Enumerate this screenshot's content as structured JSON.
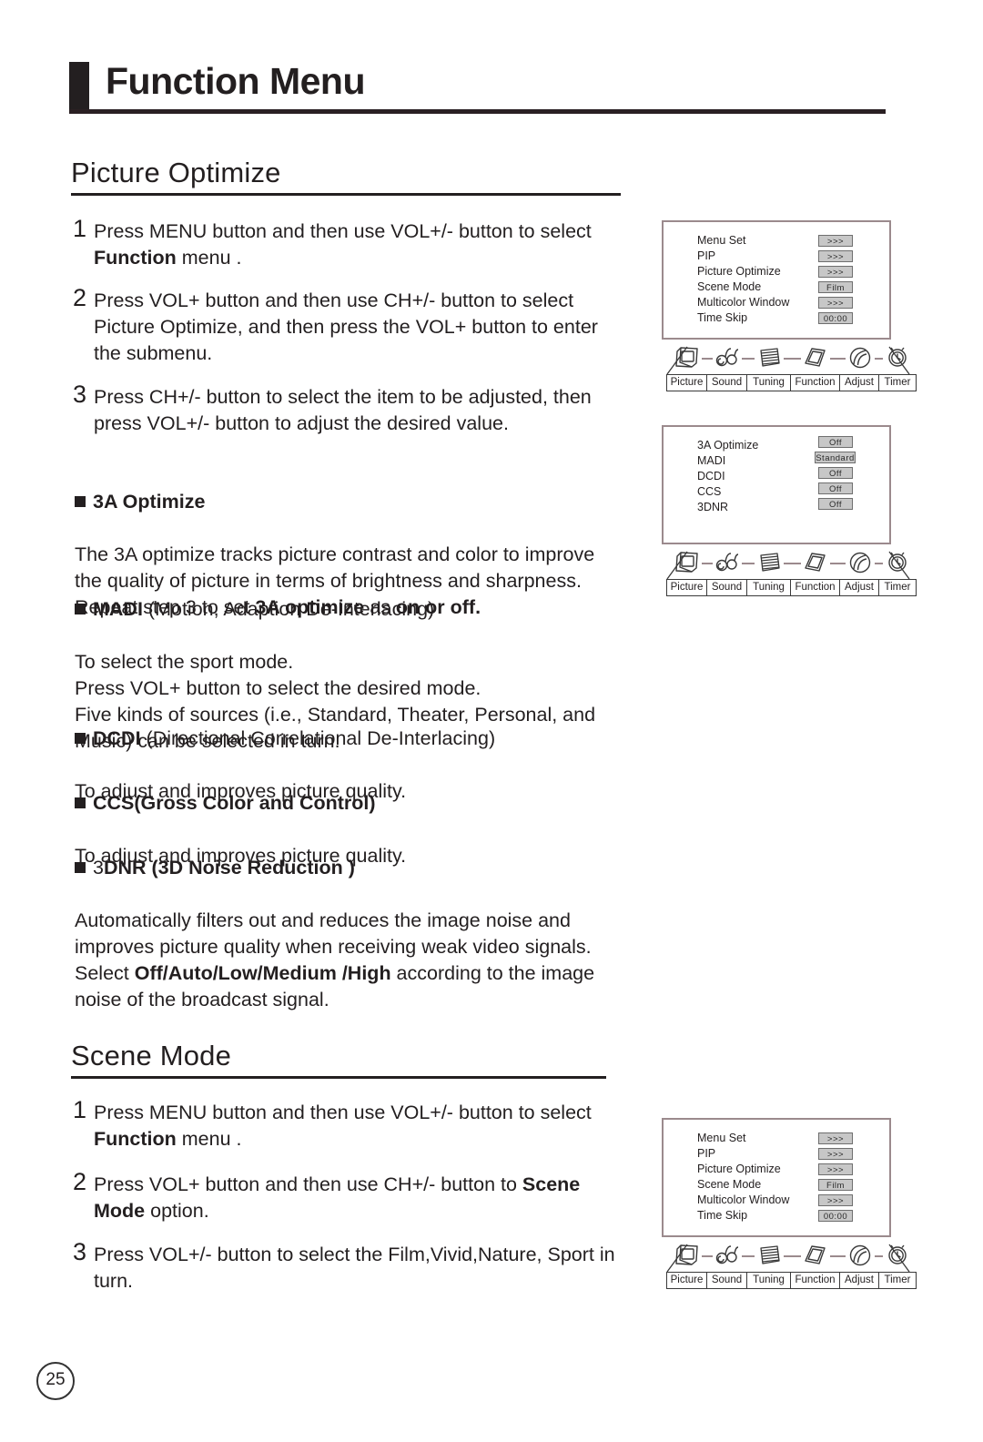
{
  "document": {
    "title": "Function Menu",
    "page_number": "25"
  },
  "sections": [
    {
      "heading": "Picture Optimize",
      "steps": [
        {
          "num": "1",
          "html": "Press MENU button and then use VOL+/- button to select <b>Function</b> menu ."
        },
        {
          "num": "2",
          "html": "Press VOL+ button and then use CH+/- button to select Picture Optimize, and then press the VOL+ button to enter the submenu."
        },
        {
          "num": "3",
          "html": "Press CH+/- button to select the item to be adjusted, then press VOL+/- button to adjust the desired value."
        }
      ],
      "topics": [
        {
          "title": "3A Optimize",
          "title_html": "<span class=\"bhead\">3A Optimize</span>",
          "body_html": "The 3A optimize tracks picture contrast and color to improve<br>the quality of picture in terms of brightness and sharpness.<br>Repeat step 3 to set <b>3A optimize</b> as <b>on or off.</b>"
        },
        {
          "title": "MADI (Motion, Adaption De-Interlacing)",
          "title_html": "<span class=\"bhead\">MADI</span> (Motion, Adaption De-Interlacing)",
          "body_html": "To select the sport mode.<br>Press VOL+ button to select the desired mode.<br>Five kinds of sources (i.e., Standard, Theater, Personal, and<br>Music) can be selected in turn."
        },
        {
          "title": "DCDI (Directional Correlational De-Interlacing)",
          "title_html": "<span class=\"bhead\">DCDI</span> (Directional Correlational De-Interlacing)",
          "body_html": "To adjust and improves picture quality."
        },
        {
          "title": "CCS(Gross Color and Control)",
          "title_html": "<span class=\"bhead\">CCS(Gross Color and Control)</span>",
          "body_html": "To adjust and improves picture quality."
        },
        {
          "title": "3DNR (3D Noise Reduction )",
          "title_html": "3<span class=\"bhead\">DNR (3D Noise Reduction )</span>",
          "body_html": "Automatically filters out and reduces the image noise and<br>improves picture quality when receiving weak video signals.<br>Select <b>Off/Auto/Low/Medium /High</b> according to the image<br>noise of the broadcast signal."
        }
      ]
    },
    {
      "heading": "Scene Mode",
      "steps": [
        {
          "num": "1",
          "html": "Press MENU button and then use VOL+/- button to select <b>Function</b> menu ."
        },
        {
          "num": "2",
          "html": "Press VOL+ button and  then use CH+/- button to <b>Scene Mode</b> option."
        },
        {
          "num": "3",
          "html": "Press VOL+/- button to select the Film,Vivid,Nature, Sport in turn."
        }
      ]
    }
  ],
  "osd_screens": [
    {
      "name": "function-menu-top",
      "rows": [
        {
          "label": "Menu Set",
          "value": ">>>"
        },
        {
          "label": "PIP",
          "value": ">>>"
        },
        {
          "label": "Picture Optimize",
          "value": ">>>"
        },
        {
          "label": "Scene Mode",
          "value": "Film"
        },
        {
          "label": "Multicolor Window",
          "value": ">>>"
        },
        {
          "label": "Time Skip",
          "value": "00:00"
        }
      ],
      "tabs": [
        "Picture",
        "Sound",
        "Tuning",
        "Function",
        "Adjust",
        "Timer"
      ],
      "icons": [
        "picture-icon",
        "sound-icon",
        "tuning-icon",
        "function-icon",
        "adjust-icon",
        "timer-icon"
      ]
    },
    {
      "name": "picture-optimize-submenu",
      "rows": [
        {
          "label": "3A Optimize",
          "value": "Off"
        },
        {
          "label": "MADI",
          "value": "Standard"
        },
        {
          "label": "DCDI",
          "value": "Off"
        },
        {
          "label": "CCS",
          "value": "Off"
        },
        {
          "label": "3DNR",
          "value": "Off"
        }
      ],
      "tabs": [
        "Picture",
        "Sound",
        "Tuning",
        "Function",
        "Adjust",
        "Timer"
      ],
      "icons": [
        "picture-icon",
        "sound-icon",
        "tuning-icon",
        "function-icon",
        "adjust-icon",
        "timer-icon"
      ]
    },
    {
      "name": "function-menu-bottom",
      "rows": [
        {
          "label": "Menu Set",
          "value": ">>>"
        },
        {
          "label": "PIP",
          "value": ">>>"
        },
        {
          "label": "Picture Optimize",
          "value": ">>>"
        },
        {
          "label": "Scene Mode",
          "value": "Film"
        },
        {
          "label": "Multicolor Window",
          "value": ">>>"
        },
        {
          "label": "Time Skip",
          "value": "00:00"
        }
      ],
      "tabs": [
        "Picture",
        "Sound",
        "Tuning",
        "Function",
        "Adjust",
        "Timer"
      ],
      "icons": [
        "picture-icon",
        "sound-icon",
        "tuning-icon",
        "function-icon",
        "adjust-icon",
        "timer-icon"
      ]
    }
  ],
  "colors": {
    "ink": "#231f20",
    "osd_border": "#9b8a8d",
    "osd_value_fill": "#c7c7c7"
  }
}
